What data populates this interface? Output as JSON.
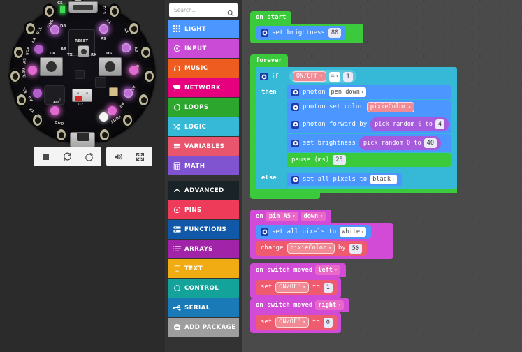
{
  "colors": {
    "workspace_bg": "#4a4a4a",
    "sim_panel_bg": "#2b2b2b",
    "cat_panel_bg": "#333333",
    "light": "#4c97ff",
    "input": "#c94bd6",
    "music": "#ef5c20",
    "network": "#e6007e",
    "loops": "#2ca62c",
    "logic": "#35b9d6",
    "variables": "#e8556d",
    "math": "#8054d1",
    "advanced": "#1a2327",
    "pins": "#ef3b5a",
    "functions": "#1258a8",
    "arrays": "#a124a8",
    "text": "#f0ac12",
    "control": "#14a39b",
    "serial": "#1a7ab8",
    "addpackage": "#9e9e9e",
    "photon_blue": "#4c97ff",
    "pink_event": "#d14bd6",
    "red_var": "#ef5b6e",
    "purple_math": "#a55bdb",
    "green_loop": "#3bca3b"
  },
  "simulator": {
    "board_name": "Circuit Playground Express",
    "green_led_label": "C5",
    "silkscreen": [
      {
        "text": "D8"
      },
      {
        "text": "A8"
      },
      {
        "text": "D4"
      },
      {
        "text": "D5"
      },
      {
        "text": "TX"
      },
      {
        "text": "RX"
      },
      {
        "text": "RESET"
      },
      {
        "text": "A9"
      },
      {
        "text": "D7"
      },
      {
        "text": "A0"
      },
      {
        "text": "D13"
      }
    ],
    "pads": [
      {
        "label": "GND"
      },
      {
        "label": "SCL"
      },
      {
        "label": "A4"
      },
      {
        "label": "SDA"
      },
      {
        "label": "A5"
      },
      {
        "label": "3.3V"
      },
      {
        "label": "RX"
      },
      {
        "label": "A6"
      },
      {
        "label": "TX"
      },
      {
        "label": "A7"
      },
      {
        "label": "GND"
      },
      {
        "label": "VOUT"
      },
      {
        "label": "A0"
      },
      {
        "label": "A1"
      },
      {
        "label": "GND"
      },
      {
        "label": "A2"
      },
      {
        "label": "A3"
      },
      {
        "label": "A1"
      }
    ],
    "toolbar": {
      "stop_label": "stop-button",
      "restart_label": "restart-button",
      "debug_label": "debug-button",
      "mute_label": "mute-button",
      "fullscreen_label": "fullscreen-button"
    }
  },
  "search": {
    "placeholder": "Search...",
    "value": "",
    "icon": "search-icon"
  },
  "categories": [
    {
      "label": "LIGHT",
      "color": "#4c97ff",
      "icon": "grid-dots-icon"
    },
    {
      "label": "INPUT",
      "color": "#c94bd6",
      "icon": "target-circle-icon"
    },
    {
      "label": "MUSIC",
      "color": "#ef5c20",
      "icon": "headphones-icon"
    },
    {
      "label": "NETWORK",
      "color": "#e6007e",
      "icon": "speech-bubble-icon"
    },
    {
      "label": "LOOPS",
      "color": "#2ca62c",
      "icon": "refresh-arrow-icon"
    },
    {
      "label": "LOGIC",
      "color": "#35b9d6",
      "icon": "shuffle-arrows-icon"
    },
    {
      "label": "VARIABLES",
      "color": "#e8556d",
      "icon": "list-lines-icon"
    },
    {
      "label": "MATH",
      "color": "#8054d1",
      "icon": "calculator-icon"
    }
  ],
  "advanced_header": {
    "label": "ADVANCED",
    "color": "#1a2327",
    "icon": "chevron-up-icon"
  },
  "advanced_categories": [
    {
      "label": "PINS",
      "color": "#ef3b5a",
      "icon": "pin-circle-icon"
    },
    {
      "label": "FUNCTIONS",
      "color": "#1258a8",
      "icon": "function-rows-icon"
    },
    {
      "label": "ARRAYS",
      "color": "#a124a8",
      "icon": "ordered-list-icon"
    },
    {
      "label": "TEXT",
      "color": "#f0ac12",
      "icon": "text-t-icon"
    },
    {
      "label": "CONTROL",
      "color": "#14a39b",
      "icon": "dashed-circle-icon"
    },
    {
      "label": "SERIAL",
      "color": "#1a7ab8",
      "icon": "usb-fork-icon"
    }
  ],
  "add_package": {
    "label": "ADD PACKAGE",
    "color": "#9e9e9e",
    "icon": "plus-circle-icon"
  },
  "workspace": {
    "on_start": {
      "hat_label": "on start",
      "statements": [
        {
          "label": "set brightness",
          "value": "80"
        }
      ]
    },
    "forever": {
      "hat_label": "forever",
      "if_label": "if",
      "then_label": "then",
      "else_label": "else",
      "condition": {
        "variable": "ON/OFF",
        "operator": "=",
        "value": "1"
      },
      "then_statements": [
        {
          "label": "photon",
          "dropdown": "pen down"
        },
        {
          "label": "photon set color",
          "variable": "pixieColor"
        },
        {
          "label": "photon forward by",
          "reporter": "pick random 0 to",
          "value": "4"
        },
        {
          "label": "set brightness",
          "reporter": "pick random 0 to",
          "value": "40"
        },
        {
          "label": "pause (ms)",
          "value": "25"
        }
      ],
      "else_statements": [
        {
          "label": "set all pixels to",
          "dropdown": "black"
        }
      ]
    },
    "on_pin_down": {
      "hat_prefix": "on",
      "pin": "pin A5",
      "action": "down",
      "statements": [
        {
          "label": "set all pixels to",
          "dropdown": "white"
        },
        {
          "label": "change",
          "variable": "pixieColor",
          "mid": "by",
          "value": "50"
        }
      ]
    },
    "on_switch_left": {
      "hat_prefix": "on switch moved",
      "direction": "left",
      "statements": [
        {
          "label": "set",
          "variable": "ON/OFF",
          "mid": "to",
          "value": "1"
        }
      ]
    },
    "on_switch_right": {
      "hat_prefix": "on switch moved",
      "direction": "right",
      "statements": [
        {
          "label": "set",
          "variable": "ON/OFF",
          "mid": "to",
          "value": "0"
        }
      ]
    }
  }
}
